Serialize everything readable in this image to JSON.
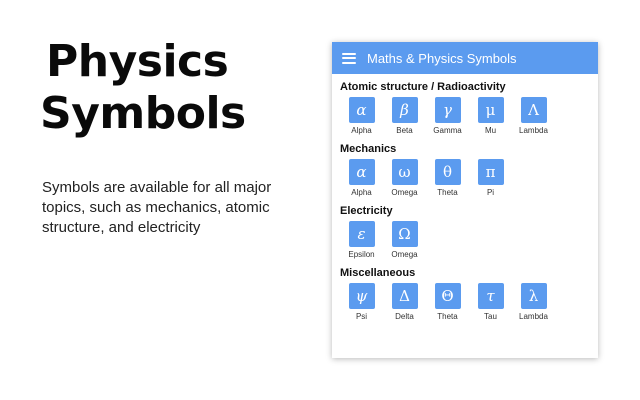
{
  "promo": {
    "title_line1": "Physics",
    "title_line2": "Symbols",
    "description": "Symbols are available for all major topics, such as mechanics, atomic structure, and electricity"
  },
  "panel": {
    "menu_icon": "hamburger-menu-icon",
    "title": "Maths & Physics Symbols",
    "accent_color": "#5b9bef",
    "sections": [
      {
        "title": "Atomic structure / Radioactivity",
        "symbols": [
          {
            "glyph": "α",
            "label": "Alpha",
            "italic": true
          },
          {
            "glyph": "β",
            "label": "Beta",
            "italic": true
          },
          {
            "glyph": "γ",
            "label": "Gamma",
            "italic": true
          },
          {
            "glyph": "μ",
            "label": "Mu",
            "italic": false
          },
          {
            "glyph": "Λ",
            "label": "Lambda",
            "italic": false
          }
        ]
      },
      {
        "title": "Mechanics",
        "symbols": [
          {
            "glyph": "α",
            "label": "Alpha",
            "italic": true
          },
          {
            "glyph": "ω",
            "label": "Omega",
            "italic": false
          },
          {
            "glyph": "θ",
            "label": "Theta",
            "italic": false
          },
          {
            "glyph": "π",
            "label": "Pi",
            "italic": false
          }
        ]
      },
      {
        "title": "Electricity",
        "symbols": [
          {
            "glyph": "ε",
            "label": "Epsilon",
            "italic": true
          },
          {
            "glyph": "Ω",
            "label": "Omega",
            "italic": false
          }
        ]
      },
      {
        "title": "Miscellaneous",
        "symbols": [
          {
            "glyph": "ψ",
            "label": "Psi",
            "italic": true
          },
          {
            "glyph": "Δ",
            "label": "Delta",
            "italic": false
          },
          {
            "glyph": "Θ",
            "label": "Theta",
            "italic": false
          },
          {
            "glyph": "τ",
            "label": "Tau",
            "italic": true
          },
          {
            "glyph": "λ",
            "label": "Lambda",
            "italic": false
          }
        ]
      }
    ]
  }
}
